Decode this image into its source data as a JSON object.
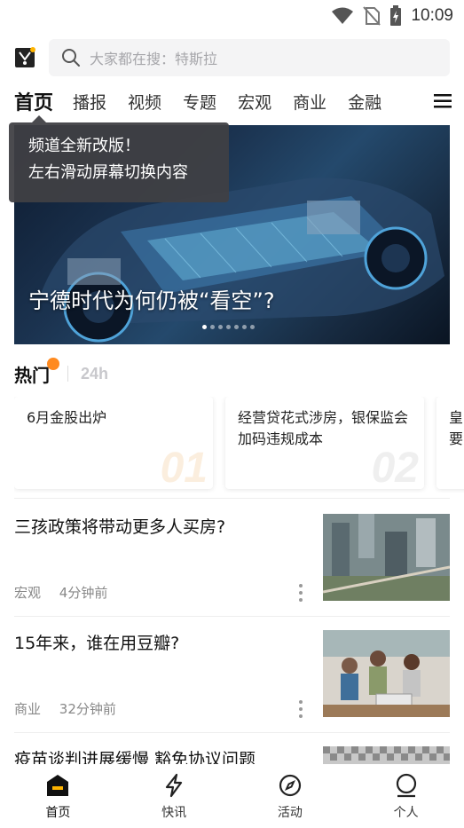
{
  "status_bar": {
    "time": "10:09",
    "icons": [
      "wifi-icon",
      "no-sim-icon",
      "battery-charging-icon"
    ]
  },
  "search": {
    "logo_icon": "app-logo-icon",
    "placeholder": "大家都在搜：特斯拉"
  },
  "tabs": [
    "首页",
    "播报",
    "视频",
    "专题",
    "宏观",
    "商业",
    "金融"
  ],
  "active_tab_index": 0,
  "tooltip": {
    "line1": "频道全新改版！",
    "line2": "左右滑动屏幕切换内容"
  },
  "hero": {
    "title": "宁德时代为何仍被“看空”?",
    "slide_count": 7,
    "active_slide": 1
  },
  "hot": {
    "title": "热门",
    "tab_24h": "24h",
    "cards": [
      {
        "text": "6月金股出炉",
        "number": "01"
      },
      {
        "text": "经营贷花式涉房，银保监会加码违规成本",
        "number": "02"
      },
      {
        "text": "皇要",
        "number": ""
      }
    ]
  },
  "news": [
    {
      "title": "三孩政策将带动更多人买房?",
      "category": "宏观",
      "time": "4分钟前",
      "thumb": "aerial-city-image"
    },
    {
      "title": "15年来，谁在用豆瓣?",
      "category": "商业",
      "time": "32分钟前",
      "thumb": "people-laptop-image"
    },
    {
      "title": "疫苗谈判进展缓慢 豁免协议问题",
      "category": "",
      "time": "",
      "thumb": "pattern-image"
    }
  ],
  "bottom_nav": [
    {
      "label": "首页",
      "icon": "home-icon"
    },
    {
      "label": "快讯",
      "icon": "flash-icon"
    },
    {
      "label": "活动",
      "icon": "compass-icon"
    },
    {
      "label": "个人",
      "icon": "profile-icon"
    }
  ],
  "colors": {
    "accent": "#ffb400",
    "hot_fire": "#ff8a1f",
    "card_num_1": "#fbeede",
    "card_num_2": "#efefef"
  }
}
